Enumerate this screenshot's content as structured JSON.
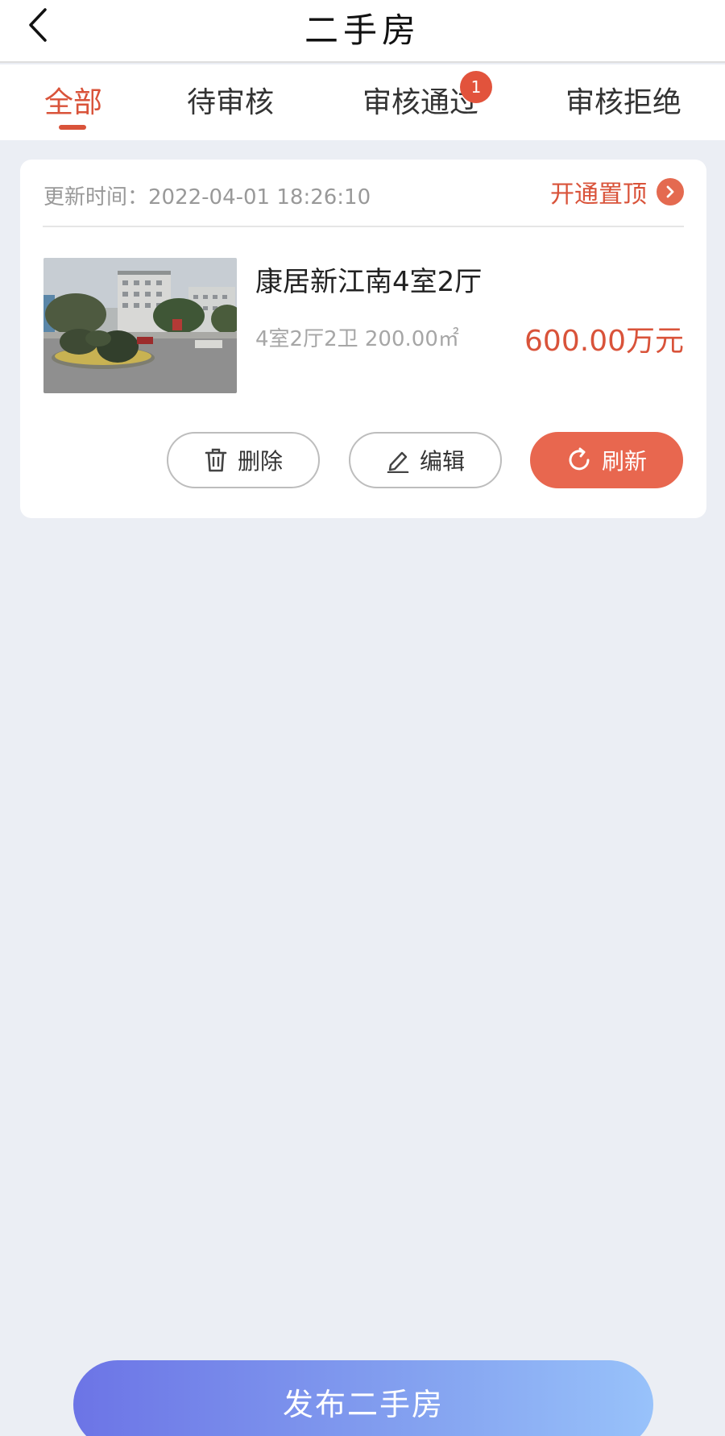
{
  "header": {
    "title": "二手房",
    "back_icon": "chevron-left-icon"
  },
  "tabs": [
    {
      "label": "全部",
      "active": true
    },
    {
      "label": "待审核",
      "active": false
    },
    {
      "label": "审核通过",
      "active": false,
      "badge": "1"
    },
    {
      "label": "审核拒绝",
      "active": false
    }
  ],
  "listing": {
    "update_time": "更新时间：2022-04-01 18:26:10",
    "promote_label": "开通置顶",
    "title": "康居新江南4室2厅",
    "specs": "4室2厅2卫    200.00㎡",
    "price": "600.00万元",
    "actions": {
      "delete_label": "删除",
      "edit_label": "编辑",
      "refresh_label": "刷新"
    }
  },
  "publish_label": "发布二手房",
  "colors": {
    "accent": "#d9533a",
    "refresh_button": "#e8674f",
    "publish_gradient_start": "#6c74e6",
    "publish_gradient_end": "#98c2fa",
    "page_background": "#ebeef4"
  }
}
